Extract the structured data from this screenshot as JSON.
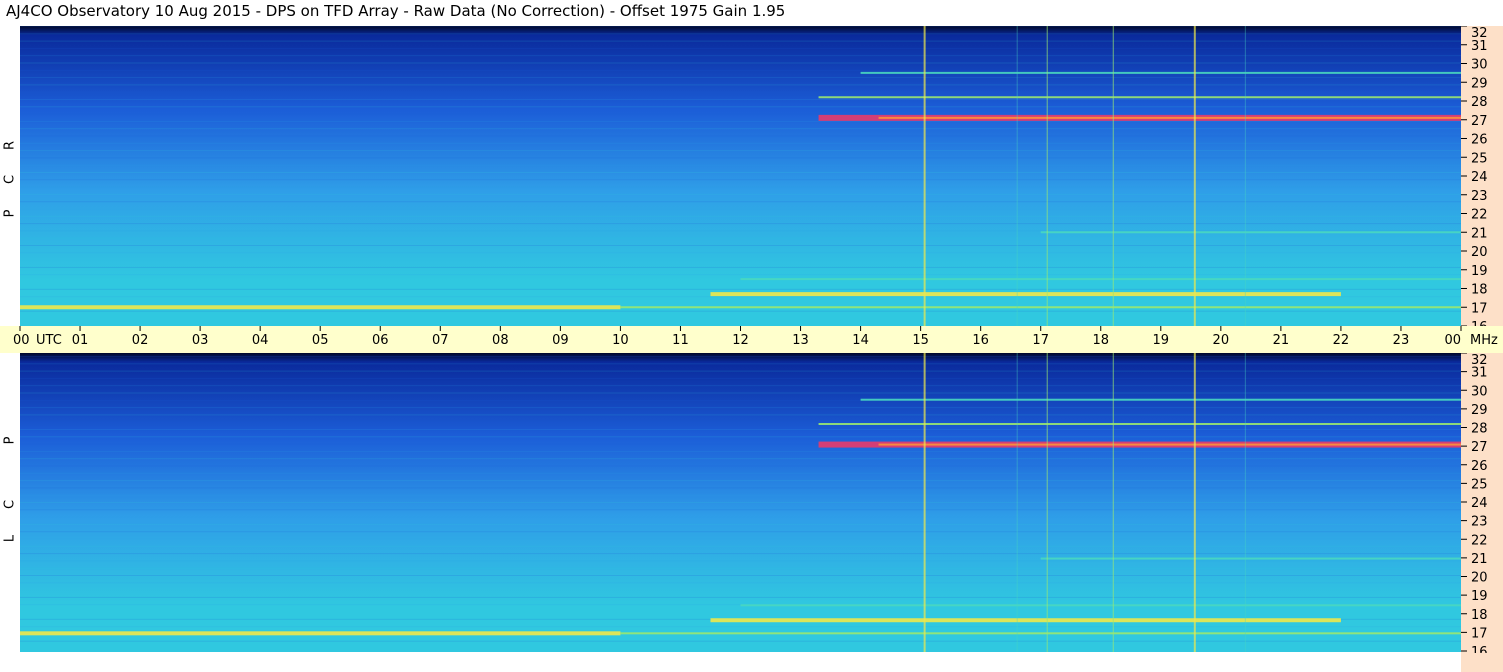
{
  "title": "AJ4CO Observatory  10 Aug 2015  -  DPS on TFD Array  -  Raw Data (No Correction)  -  Offset 1975  Gain 1.95",
  "chart_data": {
    "type": "heatmap",
    "panels": [
      {
        "name": "RCP",
        "label_letters": [
          "R",
          "C",
          "P"
        ]
      },
      {
        "name": "LCP",
        "label_letters": [
          "L",
          "C",
          "P"
        ]
      }
    ],
    "x_unit": "UTC",
    "x_ticks": [
      "00",
      "01",
      "02",
      "03",
      "04",
      "05",
      "06",
      "07",
      "08",
      "09",
      "10",
      "11",
      "12",
      "13",
      "14",
      "15",
      "16",
      "17",
      "18",
      "19",
      "20",
      "21",
      "22",
      "23",
      "00"
    ],
    "x_range": [
      0,
      24
    ],
    "y_unit": "MHz",
    "y_ticks": [
      "16",
      "17",
      "18",
      "19",
      "20",
      "21",
      "22",
      "23",
      "24",
      "25",
      "26",
      "27",
      "28",
      "29",
      "30",
      "31",
      "32"
    ],
    "y_range": [
      16,
      32
    ],
    "colormap": [
      "#000828",
      "#0a2a9c",
      "#1c5ed8",
      "#2f9ee8",
      "#30c8e0",
      "#49d8c0",
      "#9ae870",
      "#f0e84a",
      "#f88a40",
      "#e83a6a"
    ],
    "features": [
      {
        "type": "band",
        "freq_mhz": 27.1,
        "t_start_utc": 13.3,
        "t_end_utc": 24.0,
        "level": "max"
      },
      {
        "type": "band",
        "freq_mhz": 28.2,
        "t_start_utc": 13.3,
        "t_end_utc": 24.0,
        "level": "medium"
      },
      {
        "type": "band",
        "freq_mhz": 29.5,
        "t_start_utc": 14.0,
        "t_end_utc": 24.0,
        "level": "low"
      },
      {
        "type": "band",
        "freq_mhz": 17.7,
        "t_start_utc": 11.5,
        "t_end_utc": 22.0,
        "level": "high"
      },
      {
        "type": "band",
        "freq_mhz": 17.0,
        "t_start_utc": 0.0,
        "t_end_utc": 10.0,
        "level": "high"
      },
      {
        "type": "band",
        "freq_mhz": 17.0,
        "t_start_utc": 10.0,
        "t_end_utc": 24.0,
        "level": "medium"
      },
      {
        "type": "band",
        "freq_mhz": 18.5,
        "t_start_utc": 12.0,
        "t_end_utc": 24.0,
        "level": "low"
      },
      {
        "type": "band",
        "freq_mhz": 21.0,
        "t_start_utc": 17.0,
        "t_end_utc": 24.0,
        "level": "low"
      },
      {
        "type": "vline",
        "t_utc": 15.05,
        "level": "high"
      },
      {
        "type": "vline",
        "t_utc": 19.55,
        "level": "high"
      },
      {
        "type": "vline",
        "t_utc": 17.1,
        "level": "medium"
      },
      {
        "type": "vline",
        "t_utc": 18.2,
        "level": "medium"
      },
      {
        "type": "vline",
        "t_utc": 16.6,
        "level": "low"
      },
      {
        "type": "vline",
        "t_utc": 20.4,
        "level": "low"
      }
    ]
  }
}
